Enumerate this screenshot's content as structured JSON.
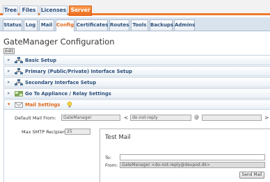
{
  "top_tabs": [
    {
      "label": "Tree",
      "active": false
    },
    {
      "label": "Files",
      "active": false
    },
    {
      "label": "Licenses",
      "active": false
    },
    {
      "label": "Server",
      "active": true
    }
  ],
  "sub_tabs": [
    {
      "label": "Status",
      "active": false
    },
    {
      "label": "Log",
      "active": false
    },
    {
      "label": "Mail",
      "active": false
    },
    {
      "label": "Config",
      "active": true
    },
    {
      "label": "Certificates",
      "active": false
    },
    {
      "label": "Routes",
      "active": false
    },
    {
      "label": "Tools",
      "active": false
    },
    {
      "label": "Backups",
      "active": false
    },
    {
      "label": "Admins",
      "active": false
    }
  ],
  "page_title": "GateManager Configuration",
  "edit_label": "Edit",
  "sections": [
    {
      "label": "Basic Setup",
      "icon": "server-icon",
      "expanded": false
    },
    {
      "label": "Primary (Public/Private) Interface Setup",
      "icon": "network-icon",
      "expanded": false
    },
    {
      "label": "Secondary Interface Setup",
      "icon": "network-icon",
      "expanded": false
    },
    {
      "label": "Go To Appliance / Relay Settings",
      "icon": "appliance-icon",
      "expanded": false
    },
    {
      "label": "Mail Settings",
      "icon": "mail-icon",
      "expanded": true
    }
  ],
  "mail": {
    "from_label": "Default Mail From:",
    "from_name": "GateManager",
    "from_lt": "<",
    "from_user": "do-not-reply",
    "at": "@",
    "from_domain": "",
    "gt": ">",
    "recipients_label": "Max SMTP Recipients:",
    "recipients_value": "25"
  },
  "test_mail": {
    "title": "Test Mail",
    "to_label": "To:",
    "to_value": "",
    "from_label": "From:",
    "from_value": "GateManager <do-not-reply@devpod.dk>",
    "send_label": "Send Mail"
  },
  "colors": {
    "accent": "#ee7a2c",
    "tab_text": "#2c4f7c"
  }
}
